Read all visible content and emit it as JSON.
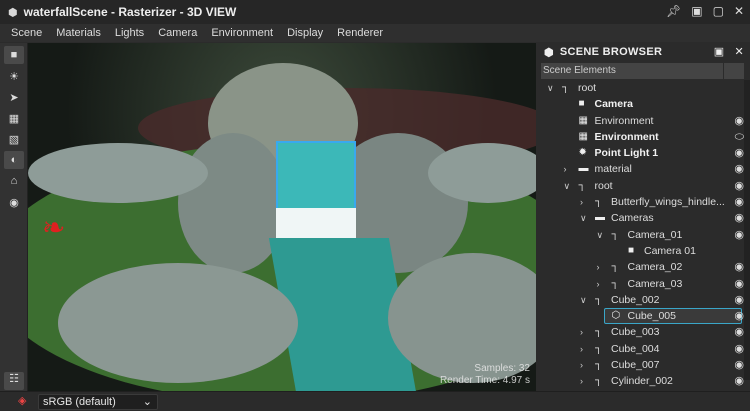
{
  "window": {
    "title": "waterfallScene - Rasterizer - 3D VIEW",
    "controls": [
      "pin",
      "dock",
      "maximize",
      "close"
    ]
  },
  "menu": [
    "Scene",
    "Materials",
    "Lights",
    "Camera",
    "Environment",
    "Display",
    "Renderer"
  ],
  "toolbar": [
    "camera-icon",
    "light-bulb-icon",
    "select-arrow-icon",
    "environment-icon",
    "texture-icon",
    "material-icon",
    "light-icon",
    "render-icon"
  ],
  "viewport": {
    "samples_label": "Samples: 32",
    "render_time_label": "Render Time: 4.97 s"
  },
  "bottom": {
    "color_space": "sRGB (default)"
  },
  "panel": {
    "title": "SCENE BROWSER",
    "column": "Scene Elements",
    "rows": [
      {
        "label": "root",
        "level": 0,
        "chev": "v",
        "icon": "transform",
        "bold": false,
        "eye": ""
      },
      {
        "label": "Camera",
        "level": 1,
        "chev": "",
        "icon": "camera",
        "bold": true,
        "eye": ""
      },
      {
        "label": "Environment",
        "level": 1,
        "chev": "",
        "icon": "environment",
        "bold": false,
        "eye": "open"
      },
      {
        "label": "Environment",
        "level": 1,
        "chev": "",
        "icon": "environment",
        "bold": true,
        "eye": "closed"
      },
      {
        "label": "Point Light 1",
        "level": 1,
        "chev": "",
        "icon": "light",
        "bold": true,
        "eye": "open"
      },
      {
        "label": "material",
        "level": 1,
        "chev": ">",
        "icon": "folder",
        "bold": false,
        "eye": "open"
      },
      {
        "label": "root",
        "level": 1,
        "chev": "v",
        "icon": "transform",
        "bold": false,
        "eye": "open"
      },
      {
        "label": "Butterfly_wings_hindle...",
        "level": 2,
        "chev": ">",
        "icon": "transform",
        "bold": false,
        "eye": "open"
      },
      {
        "label": "Cameras",
        "level": 2,
        "chev": "v",
        "icon": "folder",
        "bold": false,
        "eye": "open"
      },
      {
        "label": "Camera_01",
        "level": 3,
        "chev": "v",
        "icon": "transform",
        "bold": false,
        "eye": "open"
      },
      {
        "label": "Camera 01",
        "level": 4,
        "chev": "",
        "icon": "camera",
        "bold": false,
        "eye": ""
      },
      {
        "label": "Camera_02",
        "level": 3,
        "chev": ">",
        "icon": "transform",
        "bold": false,
        "eye": "open"
      },
      {
        "label": "Camera_03",
        "level": 3,
        "chev": ">",
        "icon": "transform",
        "bold": false,
        "eye": "open"
      },
      {
        "label": "Cube_002",
        "level": 2,
        "chev": "v",
        "icon": "transform",
        "bold": false,
        "eye": "open"
      },
      {
        "label": "Cube_005",
        "level": 3,
        "chev": "",
        "icon": "mesh",
        "bold": false,
        "eye": "open",
        "selected": true
      },
      {
        "label": "Cube_003",
        "level": 2,
        "chev": ">",
        "icon": "transform",
        "bold": false,
        "eye": "open"
      },
      {
        "label": "Cube_004",
        "level": 2,
        "chev": ">",
        "icon": "transform",
        "bold": false,
        "eye": "open"
      },
      {
        "label": "Cube_007",
        "level": 2,
        "chev": ">",
        "icon": "transform",
        "bold": false,
        "eye": "open"
      },
      {
        "label": "Cylinder_002",
        "level": 2,
        "chev": ">",
        "icon": "transform",
        "bold": false,
        "eye": "open"
      }
    ]
  }
}
